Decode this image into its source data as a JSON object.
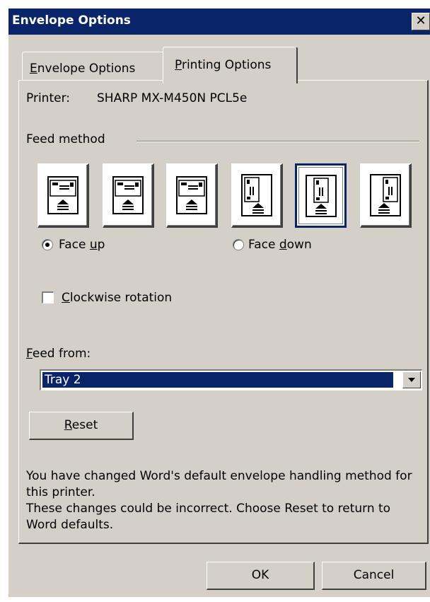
{
  "window": {
    "title": "Envelope Options",
    "close_glyph": "✕"
  },
  "tabs": [
    {
      "label": "Envelope Options",
      "mnemonic": "E",
      "rest": "nvelope Options",
      "active": false
    },
    {
      "label": "Printing Options",
      "mnemonic": "P",
      "rest": "rinting Options",
      "active": true
    }
  ],
  "printer": {
    "label": "Printer:",
    "name": "SHARP MX-M450N PCL5e"
  },
  "feed_method": {
    "legend": "Feed method",
    "options": [
      {
        "icon": "feed-landscape-left-icon",
        "selected": false
      },
      {
        "icon": "feed-landscape-center-icon",
        "selected": false
      },
      {
        "icon": "feed-landscape-right-icon",
        "selected": false
      },
      {
        "icon": "feed-portrait-left-icon",
        "selected": false
      },
      {
        "icon": "feed-portrait-center-icon",
        "selected": true
      },
      {
        "icon": "feed-portrait-right-icon",
        "selected": false
      }
    ]
  },
  "face": {
    "up": {
      "label_pre": "Face ",
      "mnemonic": "u",
      "label_post": "p",
      "checked": true
    },
    "down": {
      "label_pre": "Face ",
      "mnemonic": "d",
      "label_post": "own",
      "checked": false
    }
  },
  "rotation": {
    "mnemonic": "C",
    "rest": "lockwise rotation",
    "checked": false
  },
  "feed_from": {
    "mnemonic": "F",
    "rest": "eed from:",
    "selected": "Tray 2"
  },
  "buttons": {
    "reset_mnemonic": "R",
    "reset_rest": "eset",
    "ok": "OK",
    "cancel": "Cancel"
  },
  "info": {
    "line1": "You have changed Word's default envelope handling method for this printer.",
    "line2": "These changes could be incorrect. Choose Reset to return to Word defaults."
  },
  "colors": {
    "titlebar": "#0a246a",
    "dialog": "#d4d0c8",
    "selection": "#0a246a"
  }
}
